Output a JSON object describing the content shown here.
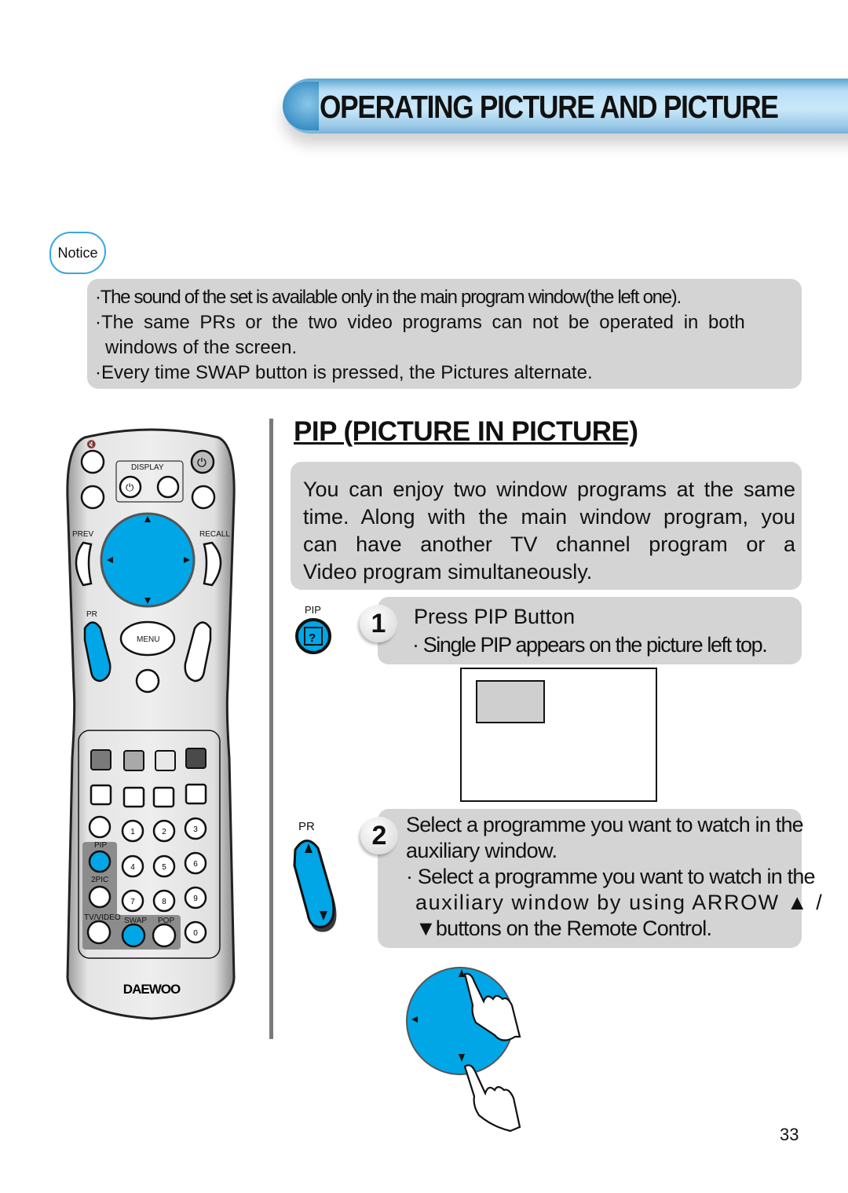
{
  "header": {
    "title": "OPERATING PICTURE AND PICTURE"
  },
  "notice": {
    "badge": "Notice",
    "items": [
      "The sound of the set is available only in the main program window(the left one).",
      "The same PRs or the two video programs can not be operated in both",
      "windows of the screen.",
      "Every time SWAP button is pressed, the Pictures alternate."
    ],
    "bullet": "·"
  },
  "section": {
    "heading": "PIP (PICTURE IN PICTURE)",
    "description_lines": [
      "You can enjoy two window programs at the same",
      "time. Along with the main window program, you",
      "can have another TV channel program or a",
      "Video program simultaneously."
    ]
  },
  "steps": [
    {
      "number": "1",
      "button_label": "PIP",
      "title": "Press PIP Button",
      "detail": "· Single PIP appears on the picture left top."
    },
    {
      "number": "2",
      "button_label": "PR",
      "title_lines": [
        "Select a programme you want to watch in the",
        "auxiliary window."
      ],
      "detail_lines": [
        "· Select a programme you want to watch in the",
        "auxiliary window by using ARROW ▲ /",
        "▼buttons on the Remote Control."
      ]
    }
  ],
  "remote": {
    "brand": "DAEWOO",
    "labels": {
      "display": "DISPLAY",
      "prev": "PREV",
      "recall": "RECALL",
      "pr": "PR",
      "menu": "MENU",
      "pip": "PIP",
      "twopic": "2PIC",
      "tvvideo": "TV/VIDEO",
      "swap": "SWAP",
      "pop": "POP"
    },
    "digits": [
      "1",
      "2",
      "3",
      "4",
      "5",
      "6",
      "7",
      "8",
      "9",
      "0"
    ],
    "accent_color": "#00a6e6"
  },
  "page_number": "33"
}
